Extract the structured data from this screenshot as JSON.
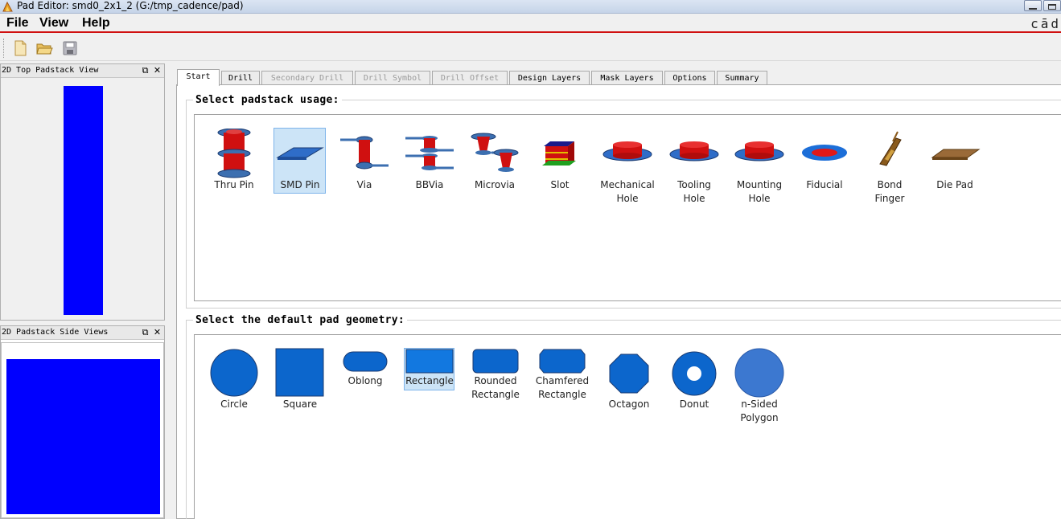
{
  "window": {
    "title": "Pad Editor: smd0_2x1_2  (G:/tmp_cadence/pad)",
    "brand": "cād"
  },
  "menu": {
    "file": "File",
    "view": "View",
    "help": "Help"
  },
  "toolbar": {
    "new_icon": "new-file-icon",
    "open_icon": "open-folder-icon",
    "save_icon": "save-disk-icon"
  },
  "panels": {
    "top_view_title": "2D Top Padstack View",
    "side_views_title": "2D Padstack Side Views",
    "pad_color": "#0000ff"
  },
  "tabs": [
    {
      "label": "Start",
      "active": true,
      "enabled": true
    },
    {
      "label": "Drill",
      "active": false,
      "enabled": true
    },
    {
      "label": "Secondary Drill",
      "active": false,
      "enabled": false
    },
    {
      "label": "Drill Symbol",
      "active": false,
      "enabled": false
    },
    {
      "label": "Drill Offset",
      "active": false,
      "enabled": false
    },
    {
      "label": "Design Layers",
      "active": false,
      "enabled": true
    },
    {
      "label": "Mask Layers",
      "active": false,
      "enabled": true
    },
    {
      "label": "Options",
      "active": false,
      "enabled": true
    },
    {
      "label": "Summary",
      "active": false,
      "enabled": true
    }
  ],
  "usage": {
    "title": "Select padstack usage:",
    "items": [
      {
        "line1": "Thru Pin",
        "line2": "",
        "selected": false
      },
      {
        "line1": "SMD Pin",
        "line2": "",
        "selected": true
      },
      {
        "line1": "Via",
        "line2": "",
        "selected": false
      },
      {
        "line1": "BBVia",
        "line2": "",
        "selected": false
      },
      {
        "line1": "Microvia",
        "line2": "",
        "selected": false
      },
      {
        "line1": "Slot",
        "line2": "",
        "selected": false
      },
      {
        "line1": "Mechanical",
        "line2": "Hole",
        "selected": false
      },
      {
        "line1": "Tooling",
        "line2": "Hole",
        "selected": false
      },
      {
        "line1": "Mounting",
        "line2": "Hole",
        "selected": false
      },
      {
        "line1": "Fiducial",
        "line2": "",
        "selected": false
      },
      {
        "line1": "Bond",
        "line2": "Finger",
        "selected": false
      },
      {
        "line1": "Die Pad",
        "line2": "",
        "selected": false
      }
    ]
  },
  "geometry": {
    "title": "Select the default pad geometry:",
    "items": [
      {
        "line1": "Circle",
        "line2": "",
        "selected": false
      },
      {
        "line1": "Square",
        "line2": "",
        "selected": false
      },
      {
        "line1": "Oblong",
        "line2": "",
        "selected": false
      },
      {
        "line1": "Rectangle",
        "line2": "",
        "selected": true
      },
      {
        "line1": "Rounded",
        "line2": "Rectangle",
        "selected": false
      },
      {
        "line1": "Chamfered",
        "line2": "Rectangle",
        "selected": false
      },
      {
        "line1": "Octagon",
        "line2": "",
        "selected": false
      },
      {
        "line1": "Donut",
        "line2": "",
        "selected": false
      },
      {
        "line1": "n-Sided",
        "line2": "Polygon",
        "selected": false
      }
    ],
    "shape_color": "#0c66cc"
  }
}
